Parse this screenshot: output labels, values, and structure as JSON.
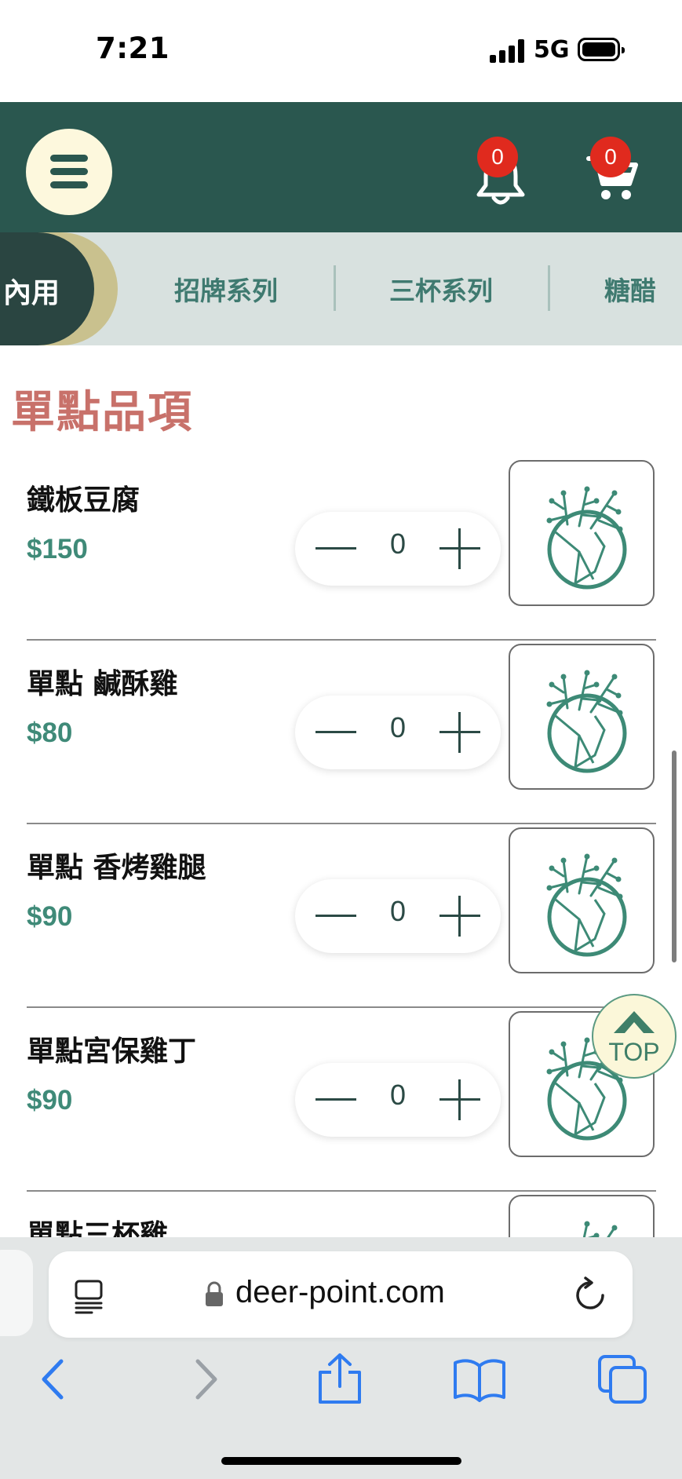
{
  "status_bar": {
    "time": "7:21",
    "network": "5G"
  },
  "header": {
    "notification_count": "0",
    "cart_count": "0"
  },
  "categories": {
    "active": "內用",
    "items": [
      "招牌系列",
      "三杯系列",
      "糖醋"
    ]
  },
  "section_title": "單點品項",
  "items": [
    {
      "name": "鐵板豆腐",
      "price": "$150",
      "qty": "0"
    },
    {
      "name": "單點 鹹酥雞",
      "price": "$80",
      "qty": "0"
    },
    {
      "name": "單點 香烤雞腿",
      "price": "$90",
      "qty": "0"
    },
    {
      "name": "單點宮保雞丁",
      "price": "$90",
      "qty": "0"
    },
    {
      "name": "單點三杯雞",
      "price": "",
      "qty": ""
    }
  ],
  "top_button": {
    "label": "TOP"
  },
  "browser": {
    "url": "deer-point.com"
  },
  "colors": {
    "header_bg": "#2a574f",
    "section_title": "#c8716a",
    "price": "#3f8a78",
    "badge": "#e02a1e",
    "browser_accent": "#2f7bf0"
  }
}
